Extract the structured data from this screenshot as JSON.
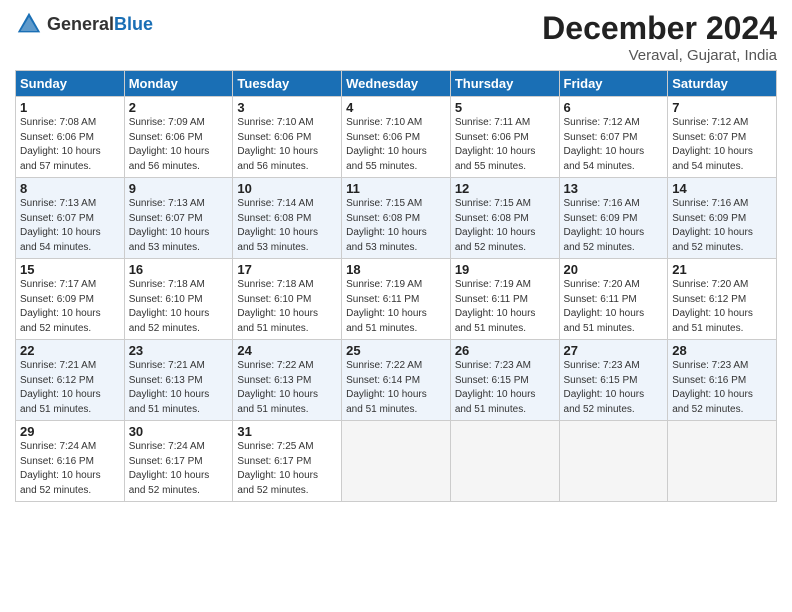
{
  "logo": {
    "general": "General",
    "blue": "Blue"
  },
  "title": "December 2024",
  "location": "Veraval, Gujarat, India",
  "weekdays": [
    "Sunday",
    "Monday",
    "Tuesday",
    "Wednesday",
    "Thursday",
    "Friday",
    "Saturday"
  ],
  "weeks": [
    [
      {
        "num": "1",
        "sunrise": "7:08 AM",
        "sunset": "6:06 PM",
        "daylight": "10 hours and 57 minutes."
      },
      {
        "num": "2",
        "sunrise": "7:09 AM",
        "sunset": "6:06 PM",
        "daylight": "10 hours and 56 minutes."
      },
      {
        "num": "3",
        "sunrise": "7:10 AM",
        "sunset": "6:06 PM",
        "daylight": "10 hours and 56 minutes."
      },
      {
        "num": "4",
        "sunrise": "7:10 AM",
        "sunset": "6:06 PM",
        "daylight": "10 hours and 55 minutes."
      },
      {
        "num": "5",
        "sunrise": "7:11 AM",
        "sunset": "6:06 PM",
        "daylight": "10 hours and 55 minutes."
      },
      {
        "num": "6",
        "sunrise": "7:12 AM",
        "sunset": "6:07 PM",
        "daylight": "10 hours and 54 minutes."
      },
      {
        "num": "7",
        "sunrise": "7:12 AM",
        "sunset": "6:07 PM",
        "daylight": "10 hours and 54 minutes."
      }
    ],
    [
      {
        "num": "8",
        "sunrise": "7:13 AM",
        "sunset": "6:07 PM",
        "daylight": "10 hours and 54 minutes."
      },
      {
        "num": "9",
        "sunrise": "7:13 AM",
        "sunset": "6:07 PM",
        "daylight": "10 hours and 53 minutes."
      },
      {
        "num": "10",
        "sunrise": "7:14 AM",
        "sunset": "6:08 PM",
        "daylight": "10 hours and 53 minutes."
      },
      {
        "num": "11",
        "sunrise": "7:15 AM",
        "sunset": "6:08 PM",
        "daylight": "10 hours and 53 minutes."
      },
      {
        "num": "12",
        "sunrise": "7:15 AM",
        "sunset": "6:08 PM",
        "daylight": "10 hours and 52 minutes."
      },
      {
        "num": "13",
        "sunrise": "7:16 AM",
        "sunset": "6:09 PM",
        "daylight": "10 hours and 52 minutes."
      },
      {
        "num": "14",
        "sunrise": "7:16 AM",
        "sunset": "6:09 PM",
        "daylight": "10 hours and 52 minutes."
      }
    ],
    [
      {
        "num": "15",
        "sunrise": "7:17 AM",
        "sunset": "6:09 PM",
        "daylight": "10 hours and 52 minutes."
      },
      {
        "num": "16",
        "sunrise": "7:18 AM",
        "sunset": "6:10 PM",
        "daylight": "10 hours and 52 minutes."
      },
      {
        "num": "17",
        "sunrise": "7:18 AM",
        "sunset": "6:10 PM",
        "daylight": "10 hours and 51 minutes."
      },
      {
        "num": "18",
        "sunrise": "7:19 AM",
        "sunset": "6:11 PM",
        "daylight": "10 hours and 51 minutes."
      },
      {
        "num": "19",
        "sunrise": "7:19 AM",
        "sunset": "6:11 PM",
        "daylight": "10 hours and 51 minutes."
      },
      {
        "num": "20",
        "sunrise": "7:20 AM",
        "sunset": "6:11 PM",
        "daylight": "10 hours and 51 minutes."
      },
      {
        "num": "21",
        "sunrise": "7:20 AM",
        "sunset": "6:12 PM",
        "daylight": "10 hours and 51 minutes."
      }
    ],
    [
      {
        "num": "22",
        "sunrise": "7:21 AM",
        "sunset": "6:12 PM",
        "daylight": "10 hours and 51 minutes."
      },
      {
        "num": "23",
        "sunrise": "7:21 AM",
        "sunset": "6:13 PM",
        "daylight": "10 hours and 51 minutes."
      },
      {
        "num": "24",
        "sunrise": "7:22 AM",
        "sunset": "6:13 PM",
        "daylight": "10 hours and 51 minutes."
      },
      {
        "num": "25",
        "sunrise": "7:22 AM",
        "sunset": "6:14 PM",
        "daylight": "10 hours and 51 minutes."
      },
      {
        "num": "26",
        "sunrise": "7:23 AM",
        "sunset": "6:15 PM",
        "daylight": "10 hours and 51 minutes."
      },
      {
        "num": "27",
        "sunrise": "7:23 AM",
        "sunset": "6:15 PM",
        "daylight": "10 hours and 52 minutes."
      },
      {
        "num": "28",
        "sunrise": "7:23 AM",
        "sunset": "6:16 PM",
        "daylight": "10 hours and 52 minutes."
      }
    ],
    [
      {
        "num": "29",
        "sunrise": "7:24 AM",
        "sunset": "6:16 PM",
        "daylight": "10 hours and 52 minutes."
      },
      {
        "num": "30",
        "sunrise": "7:24 AM",
        "sunset": "6:17 PM",
        "daylight": "10 hours and 52 minutes."
      },
      {
        "num": "31",
        "sunrise": "7:25 AM",
        "sunset": "6:17 PM",
        "daylight": "10 hours and 52 minutes."
      },
      null,
      null,
      null,
      null
    ]
  ]
}
